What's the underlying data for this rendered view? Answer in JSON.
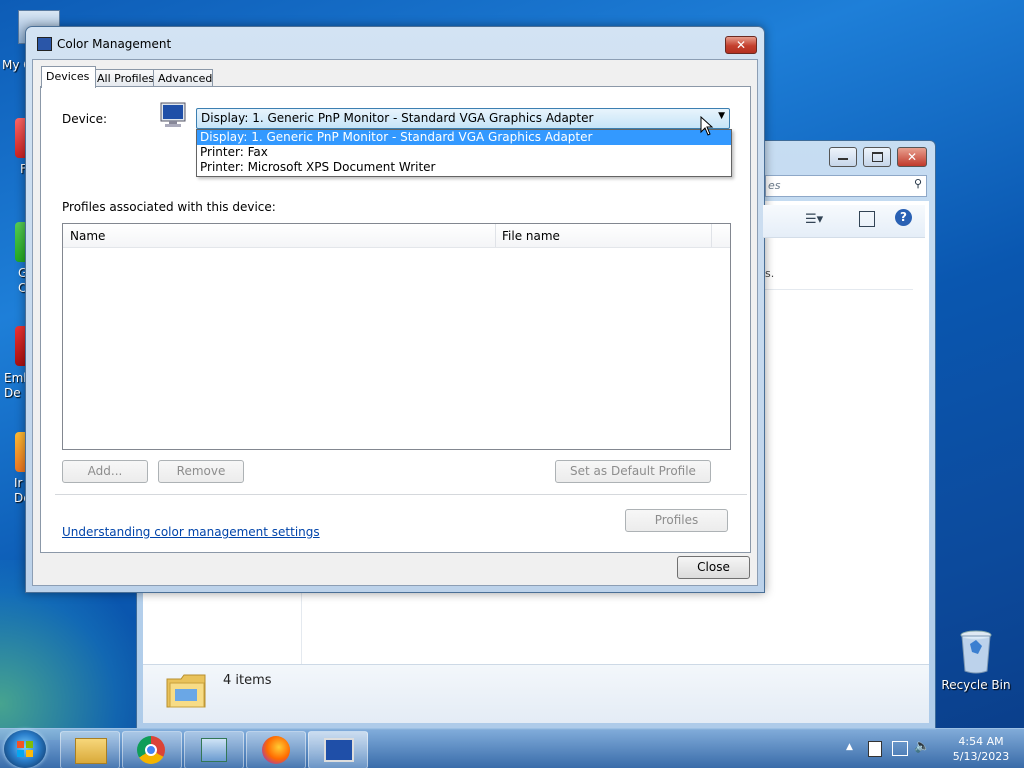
{
  "desktop": {
    "icons_left": [
      {
        "label": "My C"
      },
      {
        "label": "F"
      },
      {
        "label": "G\nC"
      },
      {
        "label": "Emb\nDe"
      },
      {
        "label": "Ir\nDe"
      }
    ],
    "recycle_bin": {
      "label": "Recycle Bin"
    }
  },
  "explorer_window": {
    "search_placeholder": "es",
    "partial_text": "s.",
    "status_text": "4 items"
  },
  "dialog": {
    "title": "Color Management",
    "tabs": [
      {
        "label": "Devices",
        "active": true
      },
      {
        "label": "All Profiles",
        "active": false
      },
      {
        "label": "Advanced",
        "active": false
      }
    ],
    "device_label": "Device:",
    "device_selected": "Display: 1. Generic PnP Monitor - Standard VGA Graphics Adapter",
    "device_options": [
      "Display: 1. Generic PnP Monitor - Standard VGA Graphics Adapter",
      "Printer: Fax",
      "Printer: Microsoft XPS Document Writer"
    ],
    "profiles_label": "Profiles associated with this device:",
    "columns": [
      "Name",
      "File name"
    ],
    "buttons": {
      "add": "Add...",
      "remove": "Remove",
      "set_default": "Set as Default Profile",
      "profiles": "Profiles",
      "close": "Close"
    },
    "link": "Understanding color management settings"
  },
  "taskbar": {
    "clock_time": "4:54 AM",
    "clock_date": "5/13/2023"
  }
}
